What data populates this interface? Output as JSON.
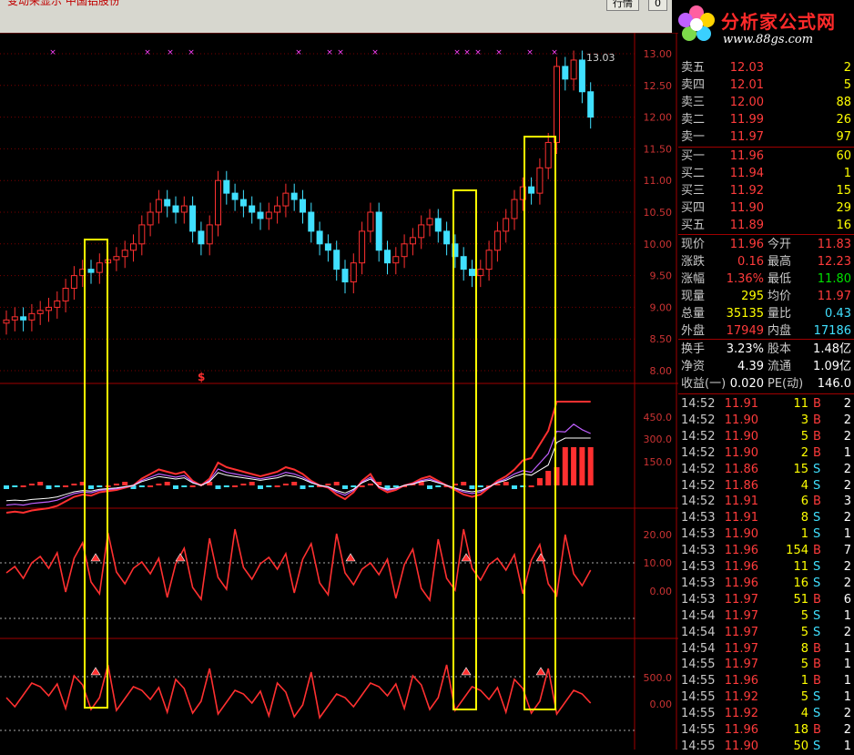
{
  "window": {
    "title": "变动来显示 中国铝股份",
    "btn1": "行情",
    "btn2": "0"
  },
  "logo": {
    "brand": "分析家公式网",
    "url": "www.88gs.com"
  },
  "price_axis": [
    "13.00",
    "12.50",
    "12.00",
    "11.50",
    "11.00",
    "10.50",
    "10.00",
    "9.50",
    "9.00",
    "8.50",
    "8.00"
  ],
  "macd_axis": [
    "450.0",
    "300.0",
    "150.0"
  ],
  "ind1_axis": [
    "20.00",
    "10.00",
    "0.00"
  ],
  "ind2_axis": [
    "500.0",
    "0.00"
  ],
  "high_label": "13.03",
  "signal_mark": "$",
  "order_book": {
    "sell": [
      {
        "label": "卖五",
        "price": "12.03",
        "vol": "2"
      },
      {
        "label": "卖四",
        "price": "12.01",
        "vol": "5"
      },
      {
        "label": "卖三",
        "price": "12.00",
        "vol": "88"
      },
      {
        "label": "卖二",
        "price": "11.99",
        "vol": "26"
      },
      {
        "label": "卖一",
        "price": "11.97",
        "vol": "97"
      }
    ],
    "buy": [
      {
        "label": "买一",
        "price": "11.96",
        "vol": "60"
      },
      {
        "label": "买二",
        "price": "11.94",
        "vol": "1"
      },
      {
        "label": "买三",
        "price": "11.92",
        "vol": "15"
      },
      {
        "label": "买四",
        "price": "11.90",
        "vol": "29"
      },
      {
        "label": "买五",
        "price": "11.89",
        "vol": "16"
      }
    ]
  },
  "quote": [
    {
      "l1": "现价",
      "v1": "11.96",
      "l2": "今开",
      "v2": "11.83"
    },
    {
      "l1": "涨跌",
      "v1": "0.16",
      "l2": "最高",
      "v2": "12.23"
    },
    {
      "l1": "涨幅",
      "v1": "1.36%",
      "l2": "最低",
      "v2": "11.80"
    },
    {
      "l1": "现量",
      "v1": "295",
      "l2": "均价",
      "v2": "11.97"
    },
    {
      "l1": "总量",
      "v1": "35135",
      "l2": "量比",
      "v2": "0.43"
    },
    {
      "l1": "外盘",
      "v1": "17949",
      "l2": "内盘",
      "v2": "17186"
    }
  ],
  "stats": [
    {
      "l1": "换手",
      "v1": "3.23%",
      "l2": "股本",
      "v2": "1.48亿"
    },
    {
      "l1": "净资",
      "v1": "4.39",
      "l2": "流通",
      "v2": "1.09亿"
    },
    {
      "l1": "收益(一)",
      "v1": "0.020",
      "l2": "PE(动)",
      "v2": "146.0"
    }
  ],
  "ticks": [
    {
      "t": "14:52",
      "p": "11.91",
      "v": "11",
      "d": "B",
      "n": "2"
    },
    {
      "t": "14:52",
      "p": "11.90",
      "v": "3",
      "d": "B",
      "n": "2"
    },
    {
      "t": "14:52",
      "p": "11.90",
      "v": "5",
      "d": "B",
      "n": "2"
    },
    {
      "t": "14:52",
      "p": "11.90",
      "v": "2",
      "d": "B",
      "n": "1"
    },
    {
      "t": "14:52",
      "p": "11.86",
      "v": "15",
      "d": "S",
      "n": "2"
    },
    {
      "t": "14:52",
      "p": "11.86",
      "v": "4",
      "d": "S",
      "n": "2"
    },
    {
      "t": "14:52",
      "p": "11.91",
      "v": "6",
      "d": "B",
      "n": "3"
    },
    {
      "t": "14:53",
      "p": "11.91",
      "v": "8",
      "d": "S",
      "n": "2"
    },
    {
      "t": "14:53",
      "p": "11.90",
      "v": "1",
      "d": "S",
      "n": "1"
    },
    {
      "t": "14:53",
      "p": "11.96",
      "v": "154",
      "d": "B",
      "n": "7"
    },
    {
      "t": "14:53",
      "p": "11.96",
      "v": "11",
      "d": "S",
      "n": "2"
    },
    {
      "t": "14:53",
      "p": "11.96",
      "v": "16",
      "d": "S",
      "n": "2"
    },
    {
      "t": "14:53",
      "p": "11.97",
      "v": "51",
      "d": "B",
      "n": "6"
    },
    {
      "t": "14:54",
      "p": "11.97",
      "v": "5",
      "d": "S",
      "n": "1"
    },
    {
      "t": "14:54",
      "p": "11.97",
      "v": "5",
      "d": "S",
      "n": "2"
    },
    {
      "t": "14:54",
      "p": "11.97",
      "v": "8",
      "d": "B",
      "n": "1"
    },
    {
      "t": "14:55",
      "p": "11.97",
      "v": "5",
      "d": "B",
      "n": "1"
    },
    {
      "t": "14:55",
      "p": "11.96",
      "v": "1",
      "d": "B",
      "n": "1"
    },
    {
      "t": "14:55",
      "p": "11.92",
      "v": "5",
      "d": "S",
      "n": "1"
    },
    {
      "t": "14:55",
      "p": "11.92",
      "v": "4",
      "d": "S",
      "n": "2"
    },
    {
      "t": "14:55",
      "p": "11.96",
      "v": "18",
      "d": "B",
      "n": "2"
    },
    {
      "t": "14:55",
      "p": "11.90",
      "v": "50",
      "d": "S",
      "n": "1"
    }
  ],
  "colors": {
    "up": "#ff3030",
    "down": "#40e0ff",
    "highlight": "#ffff00",
    "grid": "#a00000"
  }
}
